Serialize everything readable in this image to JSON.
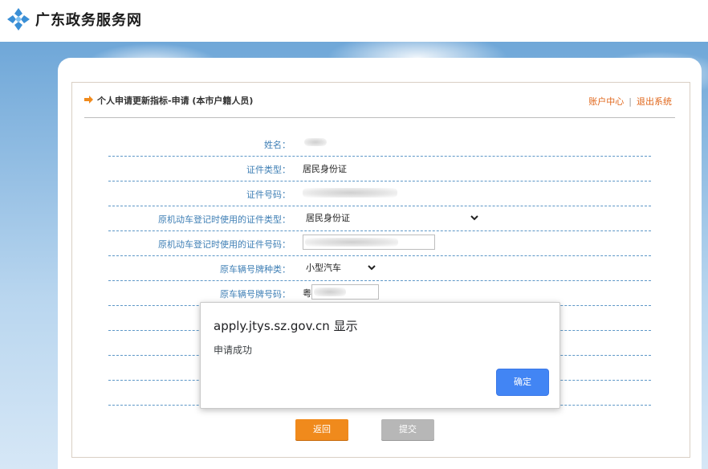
{
  "site": {
    "brand": "广东政务服务网"
  },
  "page": {
    "title": "个人申请更新指标-申请 (本市户籍人员)"
  },
  "toplinks": {
    "account_center": "账户中心",
    "separator": "|",
    "logout": "退出系统"
  },
  "form": {
    "name_label": "姓名：",
    "id_type_label": "证件类型：",
    "id_type_value": "居民身份证",
    "id_number_label": "证件号码：",
    "orig_id_type_label": "原机动车登记时使用的证件类型：",
    "orig_id_type_value": "居民身份证",
    "orig_id_number_label": "原机动车登记时使用的证件号码：",
    "plate_type_label": "原车辆号牌种类：",
    "plate_type_value": "小型汽车",
    "plate_number_label": "原车辆号牌号码：",
    "plate_prefix": "粤"
  },
  "buttons": {
    "back": "返回",
    "submit": "提交"
  },
  "dialog": {
    "title": "apply.jtys.sz.gov.cn 显示",
    "message": "申请成功",
    "ok": "确定"
  },
  "colors": {
    "accent_orange": "#f08a1c",
    "label_blue": "#3f7fb5",
    "dialog_button": "#4285f4"
  }
}
